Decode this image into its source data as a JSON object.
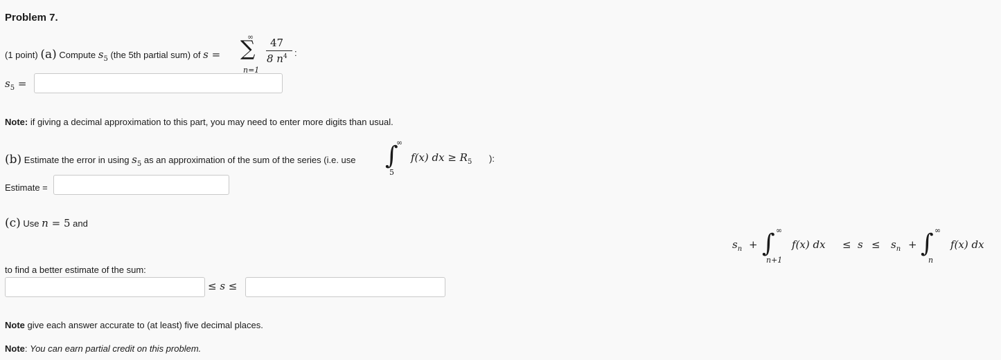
{
  "problem": {
    "title": "Problem 7."
  },
  "part_a": {
    "points": "(1 point)",
    "label": "(a)",
    "text": "Compute",
    "s5": "s",
    "s5_sub": "5",
    "text2": "(the 5th partial sum) of",
    "s_eq": "s =",
    "sum_top": "∞",
    "sum_symbol": "∑",
    "sum_bottom": "n=1",
    "num": "47",
    "den": "8 n",
    "den_exp": "4",
    "colon": ":",
    "answer_label_var": "s",
    "answer_label_sub": "5",
    "answer_label_eq": "=",
    "answer_value": ""
  },
  "note1": {
    "bold": "Note:",
    "text": "if giving a decimal approximation to this part, you may need to enter more digits than usual."
  },
  "part_b": {
    "label": "(b)",
    "text": "Estimate the error in using",
    "s5": "s",
    "s5_sub": "5",
    "text2": "as an approximation of the sum of the series (i.e. use",
    "int_upper": "∞",
    "int_lower": "5",
    "integrand": "f(x) dx ≥ R",
    "r_sub": "5",
    "close": "):",
    "estimate_label": "Estimate =",
    "estimate_value": ""
  },
  "part_c": {
    "label": "(c)",
    "text_use": "Use",
    "n_eq": "n = ",
    "n_val": "5",
    "text_and": "and",
    "formula": {
      "sn_left": "s",
      "sn_sub": "n",
      "plus": "+",
      "int1_upper": "∞",
      "int1_lower": "n+1",
      "int1_body": "f(x) dx",
      "leq1": "≤",
      "s": "s",
      "leq2": "≤",
      "sn_right": "s",
      "sn_right_sub": "n",
      "plus2": "+",
      "int2_upper": "∞",
      "int2_lower": "n",
      "int2_body": "f(x) dx"
    },
    "find_text": "to find a better estimate of the sum:",
    "between": "≤ s ≤",
    "lower_value": "",
    "upper_value": ""
  },
  "note2": {
    "bold": "Note",
    "text": "give each answer accurate to (at least) five decimal places."
  },
  "note3": {
    "bold": "Note",
    "text": "You can earn partial credit on this problem."
  }
}
